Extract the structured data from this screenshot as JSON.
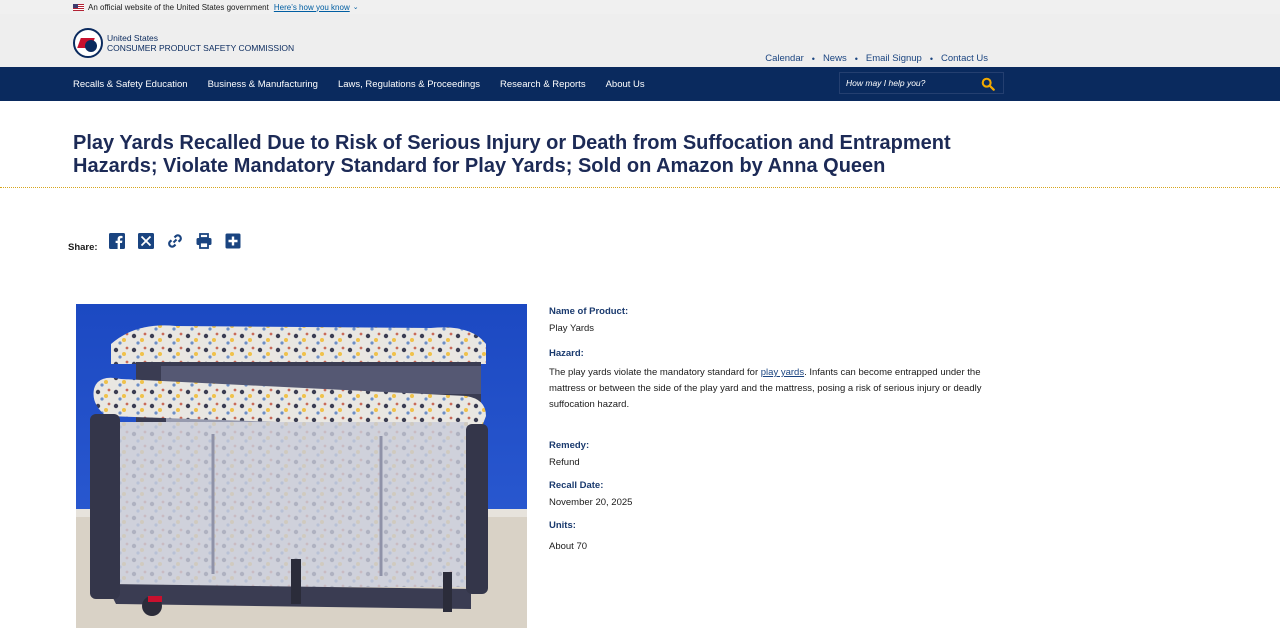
{
  "gov_banner": {
    "text": "An official website of the United States government",
    "link": "Here’s how you know"
  },
  "header": {
    "agency_line1": "United States",
    "agency_line2": "CONSUMER PRODUCT SAFETY COMMISSION",
    "utility_nav": [
      "Calendar",
      "News",
      "Email Signup",
      "Contact Us"
    ]
  },
  "main_nav": [
    "Recalls & Safety Education",
    "Business & Manufacturing",
    "Laws, Regulations & Proceedings",
    "Research & Reports",
    "About Us"
  ],
  "search": {
    "placeholder": "How may I help you?"
  },
  "page": {
    "title": "Play Yards Recalled Due to Risk of Serious Injury or Death from Suffocation and Entrapment Hazards; Violate Mandatory Standard for Play Yards; Sold on Amazon by Anna Queen"
  },
  "share": {
    "label": "Share:",
    "icons": [
      "facebook-icon",
      "x-icon",
      "link-icon",
      "print-icon",
      "plus-icon"
    ]
  },
  "details": {
    "product_label": "Name of Product:",
    "product_value": "Play Yards",
    "hazard_label": "Hazard:",
    "hazard_before": "The play yards violate the mandatory standard for ",
    "hazard_link": "play yards",
    "hazard_after": ". Infants can become entrapped under the mattress or between the side of the play yard and the mattress, posing a risk of serious injury or deadly suffocation hazard.",
    "remedy_label": "Remedy:",
    "remedy_value": "Refund",
    "date_label": "Recall Date:",
    "date_value": "November 20, 2025",
    "units_label": "Units:",
    "units_value": "About 70"
  },
  "colors": {
    "navy": "#0a2a5e",
    "title": "#1c2a56",
    "accent_gold": "#d7a61e",
    "search_icon": "#f2a900"
  }
}
